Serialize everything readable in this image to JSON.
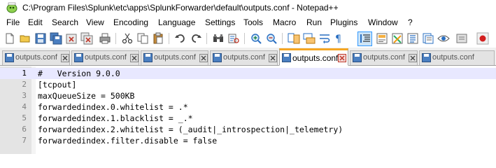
{
  "window": {
    "title": "C:\\Program Files\\Splunk\\etc\\apps\\SplunkForwarder\\default\\outputs.conf - Notepad++"
  },
  "menu": {
    "items": [
      "File",
      "Edit",
      "Search",
      "View",
      "Encoding",
      "Language",
      "Settings",
      "Tools",
      "Macro",
      "Run",
      "Plugins",
      "Window",
      "?"
    ]
  },
  "toolbar": {
    "buttons": [
      "new-file",
      "open-file",
      "save",
      "save-all",
      "close",
      "close-all",
      "print",
      "cut",
      "copy",
      "paste",
      "undo",
      "redo",
      "find",
      "replace",
      "zoom-in",
      "zoom-out",
      "sync-vertical",
      "sync-horizontal",
      "word-wrap",
      "show-all-characters",
      "indent-guide",
      "user-defined-language",
      "document-map",
      "function-list",
      "folder-as-workspace",
      "monitoring",
      "record-macro"
    ]
  },
  "tabs": [
    {
      "label": "outputs.conf",
      "active": false
    },
    {
      "label": "outputs.conf",
      "active": false
    },
    {
      "label": "outputs.conf",
      "active": false
    },
    {
      "label": "outputs.conf",
      "active": false
    },
    {
      "label": "outputs.conf",
      "active": true
    },
    {
      "label": "outputs.conf",
      "active": false
    },
    {
      "label": "outputs.conf",
      "active": false
    }
  ],
  "editor": {
    "current_line": 1,
    "lines": [
      {
        "num": "1",
        "text": "#   Version 9.0.0"
      },
      {
        "num": "2",
        "text": "[tcpout]"
      },
      {
        "num": "3",
        "text": "maxQueueSize = 500KB"
      },
      {
        "num": "4",
        "text": "forwardedindex.0.whitelist = .*"
      },
      {
        "num": "5",
        "text": "forwardedindex.1.blacklist = _.*"
      },
      {
        "num": "6",
        "text": "forwardedindex.2.whitelist = (_audit|_introspection|_telemetry)"
      },
      {
        "num": "7",
        "text": "forwardedindex.filter.disable = false"
      }
    ]
  },
  "colors": {
    "active_tab_accent": "#f5a623",
    "current_line_bg": "#e8e8ff",
    "gutter_bg": "#e4e4e4",
    "toolbar_active_bg": "#cce4f7"
  }
}
